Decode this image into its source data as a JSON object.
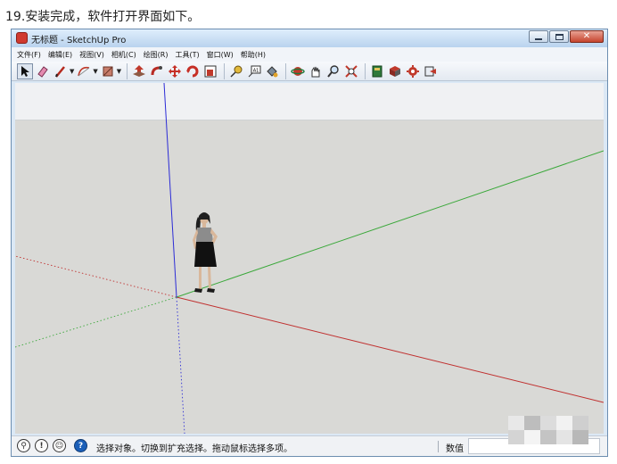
{
  "caption": "19.安装完成，软件打开界面如下。",
  "window": {
    "title": "无标题 - SketchUp Pro",
    "controls": [
      "minimize",
      "maximize",
      "close"
    ]
  },
  "menu": {
    "items": [
      "文件(F)",
      "编辑(E)",
      "视图(V)",
      "相机(C)",
      "绘图(R)",
      "工具(T)",
      "窗口(W)",
      "帮助(H)"
    ]
  },
  "toolbar": {
    "groups": [
      [
        "select-arrow-icon",
        "eraser-icon",
        "pencil-line-icon",
        "arc-icon",
        "rectangle-icon"
      ],
      [
        "push-pull-icon",
        "follow-me-icon",
        "move-icon",
        "rotate-icon",
        "scale-icon"
      ],
      [
        "tape-measure-icon",
        "text-label-icon",
        "paint-bucket-icon"
      ],
      [
        "orbit-icon",
        "pan-icon",
        "zoom-icon",
        "zoom-extents-icon"
      ],
      [
        "warehouse-icon",
        "components-icon",
        "extension-icon",
        "share-icon"
      ]
    ]
  },
  "colors": {
    "axis_red": "#c0302f",
    "axis_green": "#3aa83a",
    "axis_blue": "#2b2bd6",
    "ground": "#d9d9d6",
    "sky": "#f0f1f3"
  },
  "statusbar": {
    "icons": [
      "georef-icon",
      "credits-icon",
      "user-icon",
      "help-icon"
    ],
    "text": "选择对象。切换到扩充选择。拖动鼠标选择多项。",
    "vcb_label": "数值",
    "vcb_value": ""
  }
}
